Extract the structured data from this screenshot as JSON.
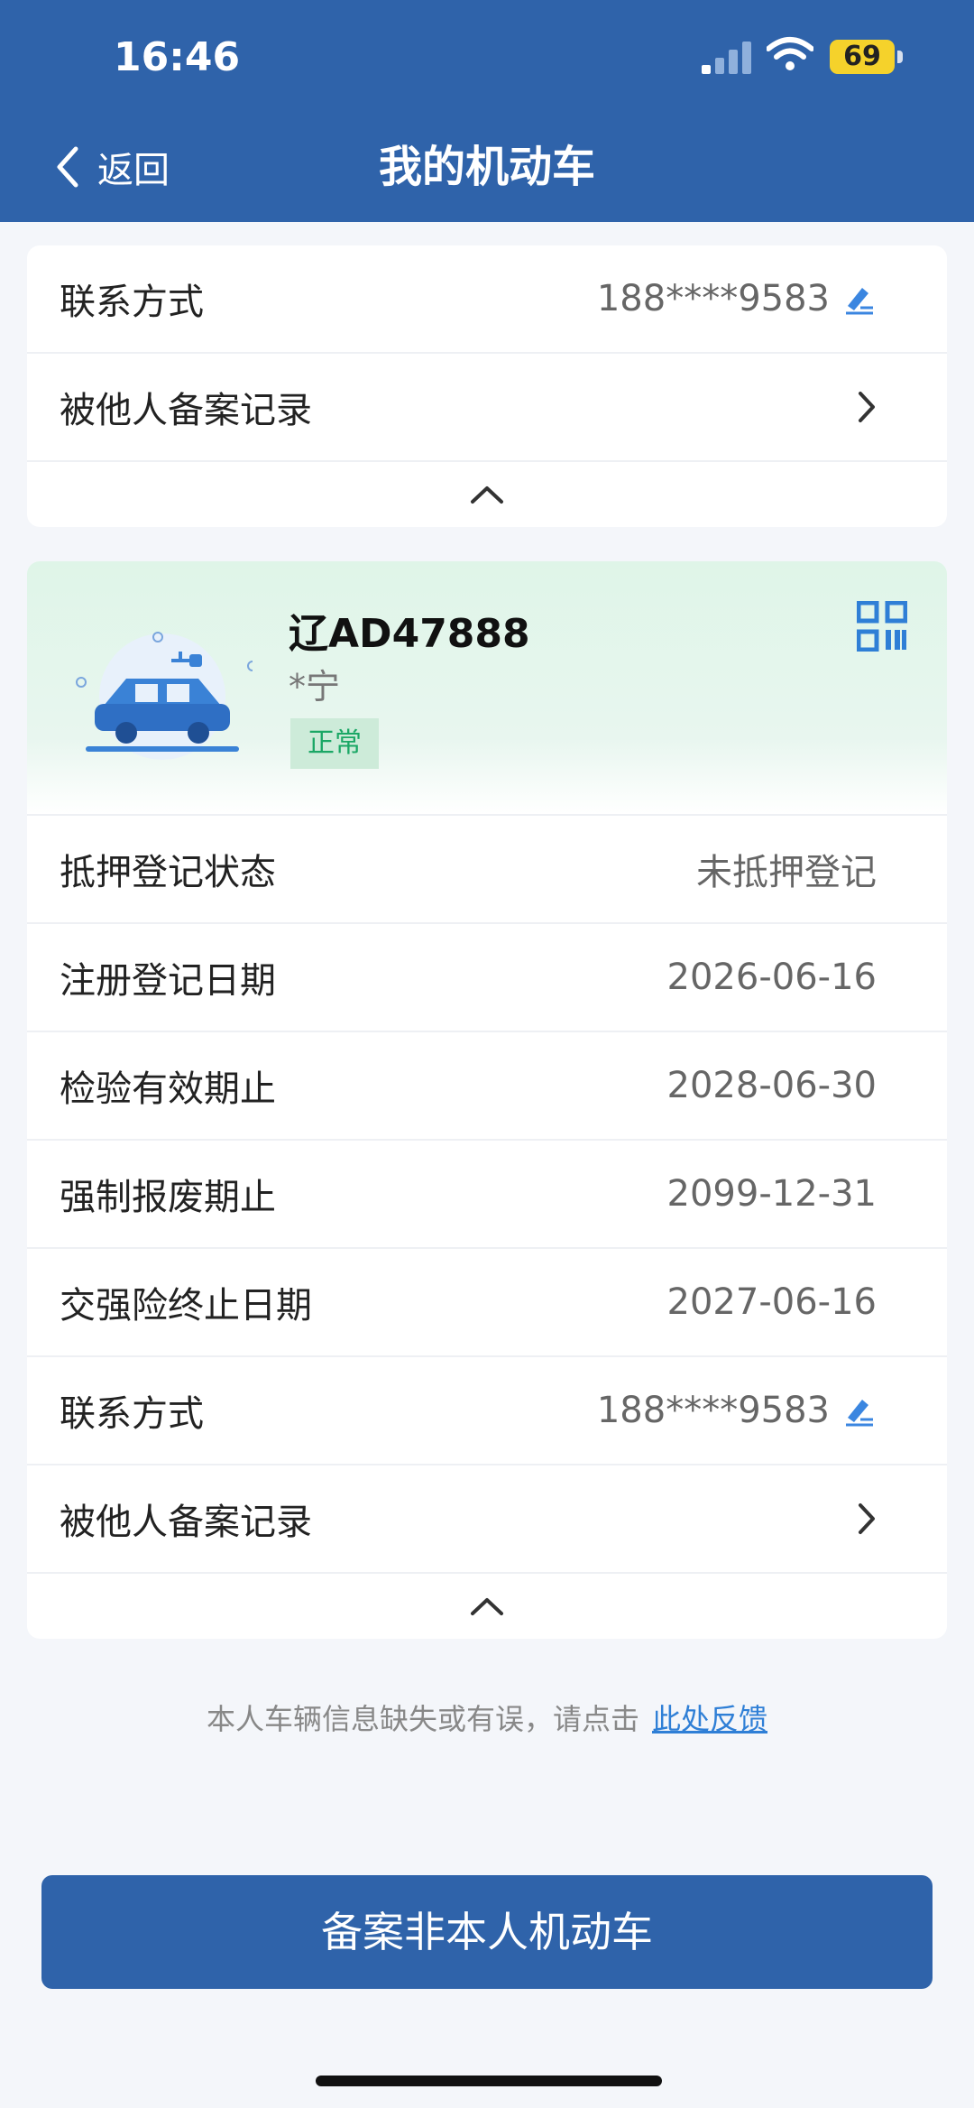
{
  "status_bar": {
    "time": "16:46",
    "battery": "69"
  },
  "nav": {
    "back_label": "返回",
    "title": "我的机动车"
  },
  "top_card": {
    "rows": [
      {
        "label": "联系方式",
        "value": "188****9583"
      },
      {
        "label": "被他人备案记录",
        "value": ""
      }
    ]
  },
  "vehicle_card": {
    "plate": "辽AD47888",
    "owner": "*宁",
    "status": "正常",
    "rows": [
      {
        "label": "抵押登记状态",
        "value": "未抵押登记"
      },
      {
        "label": "注册登记日期",
        "value": "2026-06-16"
      },
      {
        "label": "检验有效期止",
        "value": "2028-06-30"
      },
      {
        "label": "强制报废期止",
        "value": "2099-12-31"
      },
      {
        "label": "交强险终止日期",
        "value": "2027-06-16"
      },
      {
        "label": "联系方式",
        "value": "188****9583"
      },
      {
        "label": "被他人备案记录",
        "value": ""
      }
    ]
  },
  "feedback": {
    "text": "本人车辆信息缺失或有误，请点击",
    "link": "此处反馈"
  },
  "primary_button": {
    "label": "备案非本人机动车"
  },
  "colors": {
    "primary": "#2f63aa",
    "success": "#1aa765",
    "link": "#2f7fd6"
  }
}
